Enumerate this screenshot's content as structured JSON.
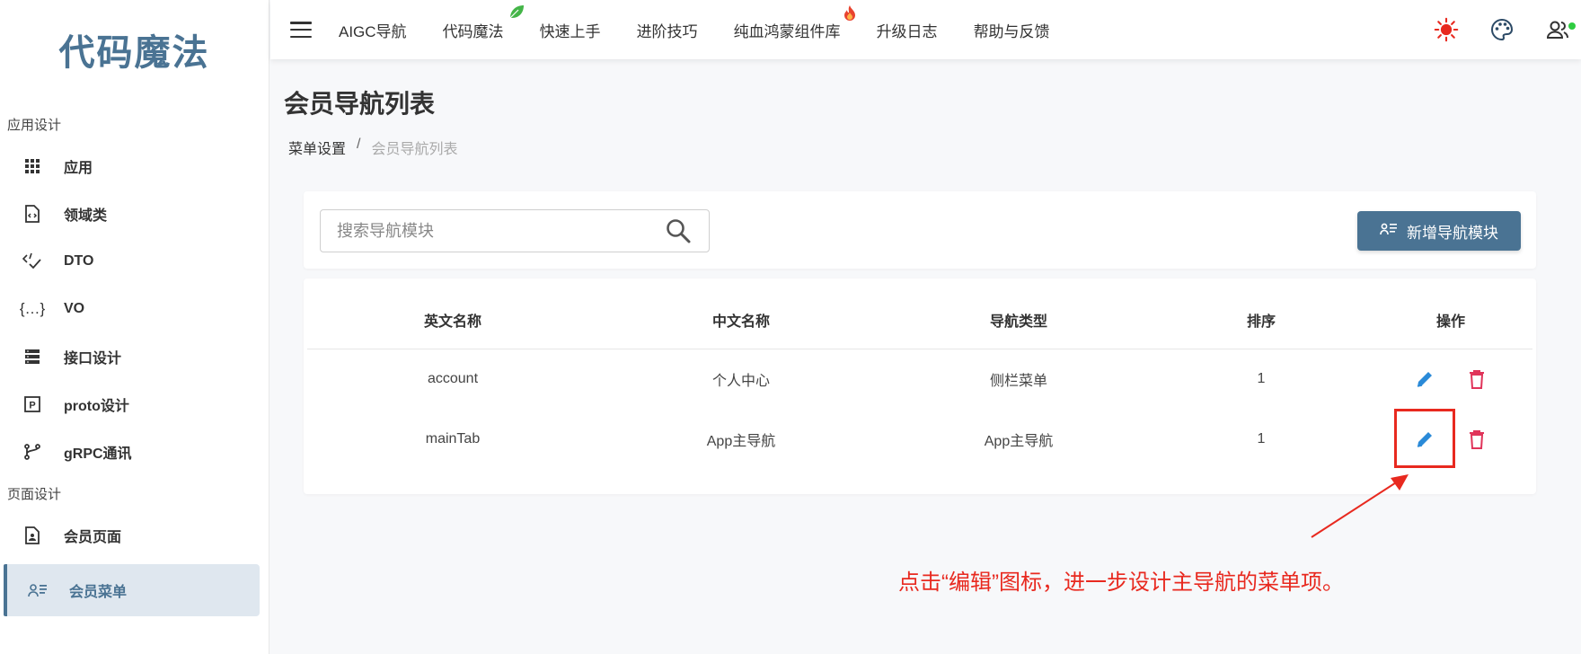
{
  "brand": {
    "title": "代码魔法"
  },
  "sidebar": {
    "sections": [
      {
        "title": "应用设计",
        "items": [
          {
            "label": "应用",
            "icon": "grid-icon"
          },
          {
            "label": "领域类",
            "icon": "code-file-icon"
          },
          {
            "label": "DTO",
            "icon": "code-check-icon"
          },
          {
            "label": "VO",
            "icon": "braces-icon"
          },
          {
            "label": "接口设计",
            "icon": "server-icon"
          },
          {
            "label": "proto设计",
            "icon": "p-box-icon"
          },
          {
            "label": "gRPC通讯",
            "icon": "branch-icon"
          }
        ]
      },
      {
        "title": "页面设计",
        "items": [
          {
            "label": "会员页面",
            "icon": "user-file-icon"
          },
          {
            "label": "会员菜单",
            "icon": "user-list-icon",
            "active": true
          }
        ]
      }
    ]
  },
  "topbar": {
    "items": [
      {
        "label": "AIGC导航"
      },
      {
        "label": "代码魔法",
        "badge": "leaf-icon"
      },
      {
        "label": "快速上手"
      },
      {
        "label": "进阶技巧"
      },
      {
        "label": "纯血鸿蒙组件库",
        "badge": "fire-icon"
      },
      {
        "label": "升级日志"
      },
      {
        "label": "帮助与反馈"
      }
    ]
  },
  "page": {
    "title": "会员导航列表",
    "breadcrumb": {
      "parent": "菜单设置",
      "separator": "/",
      "current": "会员导航列表"
    }
  },
  "search": {
    "placeholder": "搜索导航模块",
    "value": ""
  },
  "add_button": {
    "label": "新增导航模块"
  },
  "table": {
    "headers": [
      "英文名称",
      "中文名称",
      "导航类型",
      "排序",
      "操作"
    ],
    "rows": [
      {
        "en": "account",
        "zh": "个人中心",
        "type": "侧栏菜单",
        "order": "1"
      },
      {
        "en": "mainTab",
        "zh": "App主导航",
        "type": "App主导航",
        "order": "1"
      }
    ]
  },
  "annotation": {
    "text": "点击“编辑”图标，进一步设计主导航的菜单项。"
  },
  "colors": {
    "accent": "#4a7393",
    "edit": "#2a8ad8",
    "delete": "#e0345a",
    "annotation": "#e8291f",
    "sun": "#e8291f",
    "online": "#2ecc40"
  }
}
